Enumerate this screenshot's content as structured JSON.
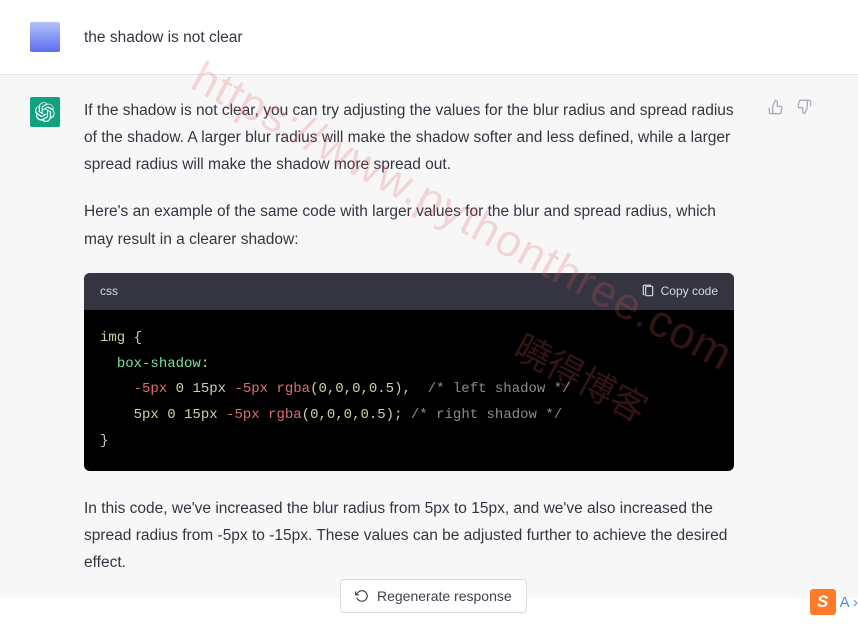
{
  "user": {
    "message": "the shadow is not  clear"
  },
  "assistant": {
    "para1": "If the shadow is not clear, you can try adjusting the values for the blur radius and spread radius of the shadow. A larger blur radius will make the shadow softer and less defined, while a larger spread radius will make the shadow more spread out.",
    "para2": "Here's an example of the same code with larger values for the blur and spread radius, which may result in a clearer shadow:",
    "code": {
      "language": "css",
      "copy_label": "Copy code",
      "lines": {
        "l1_sel": "img",
        "l1_brace": " {",
        "l2_prop": "box-shadow",
        "l2_colon": ":",
        "l3_neg": "-5px",
        "l3_mid": " 0 15px ",
        "l3_neg2": "-5px",
        "l3_func": " rgba",
        "l3_args": "(0,0,0,0.5)",
        "l3_comma": ", ",
        "l3_comment": " /* left shadow */",
        "l4_pos": "5px",
        "l4_mid": " 0 15px ",
        "l4_neg": "-5px",
        "l4_func": " rgba",
        "l4_args": "(0,0,0,0.5)",
        "l4_semi": "; ",
        "l4_comment": "/* right shadow */",
        "l5_brace": "}"
      }
    },
    "para3": "In this code, we've increased the blur radius from 5px to 15px, and we've also increased the spread radius from -5px to -15px. These values can be adjusted further to achieve the desired effect."
  },
  "ui": {
    "regenerate_label": "Regenerate response"
  },
  "watermark": {
    "url": "https://www.pythonthree.com",
    "cn": "曉得博客"
  },
  "ime": {
    "icon": "S",
    "text": "A ›"
  }
}
